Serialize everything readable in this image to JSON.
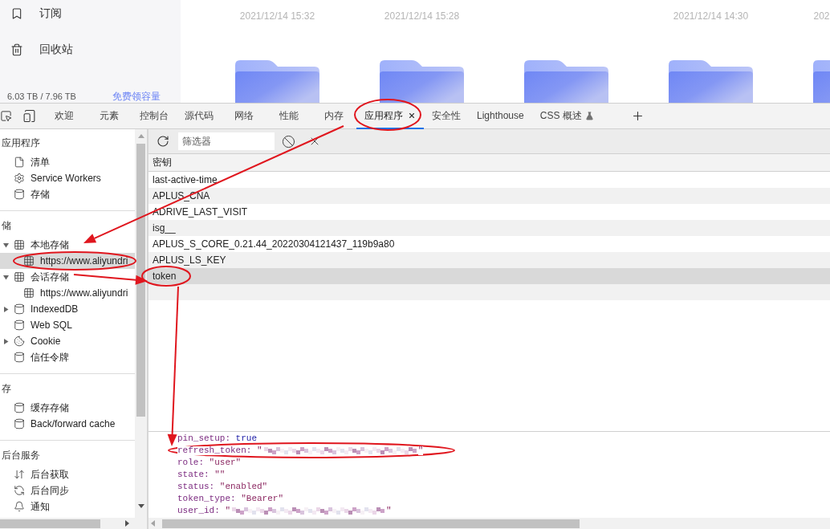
{
  "drive": {
    "nav": [
      {
        "label": "订阅",
        "kind": "bookmark"
      },
      {
        "label": "回收站",
        "kind": "trash"
      }
    ],
    "usage": "6.03 TB / 7.96 TB",
    "usage_link": "免费领容量",
    "files": [
      {
        "kind": "folder",
        "date": "2021/12/14 15:32"
      },
      {
        "kind": "folder",
        "date": "2021/12/14 15:28"
      },
      {
        "kind": "folder"
      },
      {
        "kind": "folder",
        "date": "2021/12/14 14:30"
      },
      {
        "kind": "folder",
        "date": "202"
      }
    ]
  },
  "devtools": {
    "tabs": [
      {
        "label": "欢迎",
        "selected": false
      },
      {
        "label": "元素",
        "selected": false
      },
      {
        "label": "控制台",
        "selected": false
      },
      {
        "label": "源代码",
        "selected": false
      },
      {
        "label": "网络",
        "selected": false
      },
      {
        "label": "性能",
        "selected": false
      },
      {
        "label": "内存",
        "selected": false
      },
      {
        "label": "应用程序",
        "selected": true,
        "closable": true
      },
      {
        "label": "安全性",
        "selected": false
      },
      {
        "label": "Lighthouse",
        "selected": false
      },
      {
        "label": "CSS 概述",
        "selected": false,
        "experimental": true
      }
    ],
    "application_sidebar": {
      "sections": [
        {
          "title": "应用程序",
          "items": [
            {
              "label": "清单",
              "kind": "file",
              "selected": false
            },
            {
              "label": "Service Workers",
              "kind": "gear",
              "selected": false
            },
            {
              "label": "存储",
              "kind": "database",
              "selected": false
            }
          ]
        },
        {
          "title": "储",
          "items": [
            {
              "label": "本地存储",
              "kind": "table",
              "expanded": true,
              "selected": false,
              "children": [
                {
                  "label": "https://www.aliyundri",
                  "kind": "table",
                  "selected": true
                }
              ]
            },
            {
              "label": "会话存储",
              "kind": "table",
              "expanded": true,
              "selected": false,
              "children": [
                {
                  "label": "https://www.aliyundri",
                  "kind": "table",
                  "selected": false
                }
              ]
            },
            {
              "label": "IndexedDB",
              "kind": "database",
              "expanded": false,
              "selected": false
            },
            {
              "label": "Web SQL",
              "kind": "database",
              "selected": false
            },
            {
              "label": "Cookie",
              "kind": "cookie",
              "expanded": false,
              "selected": false
            },
            {
              "label": "信任令牌",
              "kind": "database",
              "selected": false
            }
          ]
        },
        {
          "title": "存",
          "items": [
            {
              "label": "缓存存储",
              "kind": "database",
              "selected": false
            },
            {
              "label": "Back/forward cache",
              "kind": "database",
              "selected": false
            }
          ]
        },
        {
          "title": "后台服务",
          "items": [
            {
              "label": "后台获取",
              "kind": "updown",
              "selected": false
            },
            {
              "label": "后台同步",
              "kind": "sync",
              "selected": false
            },
            {
              "label": "通知",
              "kind": "bell",
              "selected": false
            }
          ]
        }
      ]
    },
    "storage": {
      "filter": {
        "placeholder": "筛选器"
      },
      "columns": [
        "密钥"
      ],
      "rows": [
        {
          "key": "last-active-time",
          "selected": false
        },
        {
          "key": "APLUS_CNA",
          "selected": false
        },
        {
          "key": "ADRIVE_LAST_VISIT",
          "selected": false
        },
        {
          "key": "isg__",
          "selected": false
        },
        {
          "key": "APLUS_S_CORE_0.21.44_20220304121437_119b9a80",
          "selected": false
        },
        {
          "key": "APLUS_LS_KEY",
          "selected": false
        },
        {
          "key": "token",
          "selected": true
        }
      ]
    },
    "preview": {
      "lines": [
        {
          "key": "pin_setup:",
          "kind": "boolean",
          "value": "true"
        },
        {
          "key": "refresh_token:",
          "kind": "redacted",
          "open": "\"",
          "close": "\""
        },
        {
          "key": "role:",
          "kind": "string",
          "value": "\"user\""
        },
        {
          "key": "state:",
          "kind": "string",
          "value": "\"\""
        },
        {
          "key": "status:",
          "kind": "string",
          "value": "\"enabled\""
        },
        {
          "key": "token_type:",
          "kind": "string",
          "value": "\"Bearer\""
        },
        {
          "key": "user_id:",
          "kind": "redacted",
          "open": "\"",
          "close": "\""
        }
      ]
    }
  }
}
